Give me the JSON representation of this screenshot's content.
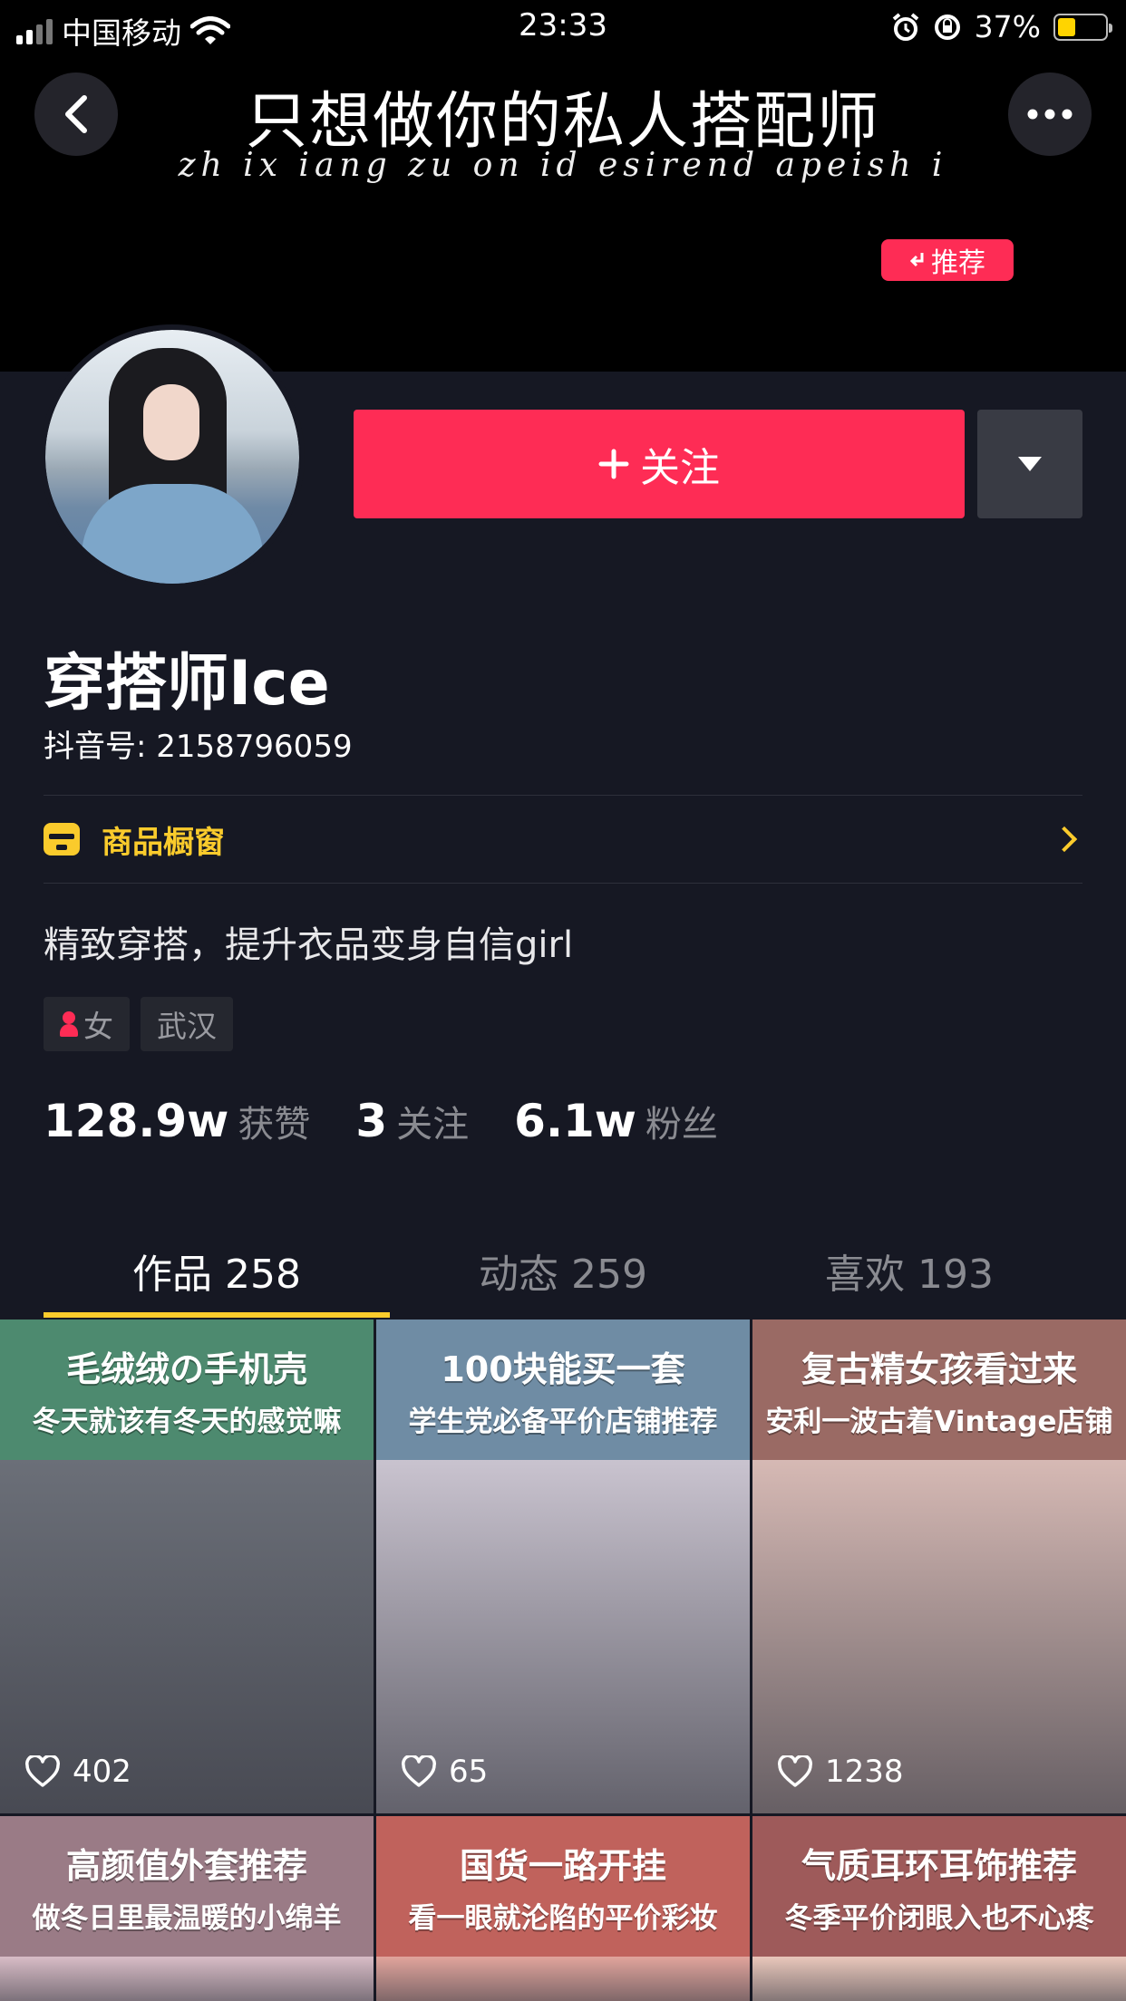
{
  "status_bar": {
    "carrier": "中国移动",
    "time": "23:33",
    "battery_percent": "37%",
    "battery_level": 0.37
  },
  "banner": {
    "title": "只想做你的私人搭配师",
    "pinyin": "zh ix iang zu on id esirend apeish i",
    "recommend_tag": "推荐"
  },
  "profile": {
    "follow_label": "关注",
    "nickname": "穿搭师Ice",
    "douyin_id": "抖音号: 2158796059",
    "shop_label": "商品橱窗",
    "bio": "精致穿搭，提升衣品变身自信girl",
    "tags": [
      "女",
      "武汉"
    ],
    "stats": [
      {
        "num": "128.9w",
        "label": "获赞"
      },
      {
        "num": "3",
        "label": "关注"
      },
      {
        "num": "6.1w",
        "label": "粉丝"
      }
    ]
  },
  "tabs": [
    {
      "label": "作品 258",
      "active": true
    },
    {
      "label": "动态 259",
      "active": false
    },
    {
      "label": "喜欢 193",
      "active": false
    }
  ],
  "videos": [
    {
      "line1": "毛绒绒の手机壳",
      "line2": "冬天就该有冬天的感觉嘛",
      "likes": "402",
      "head_color": "#4d8a6f",
      "photo_color": "#6b6f78"
    },
    {
      "line1": "100块能买一套",
      "line2": "学生党必备平价店铺推荐",
      "likes": "65",
      "head_color": "#6f8ca4",
      "photo_color": "#c9c3cf"
    },
    {
      "line1": "复古精女孩看过来",
      "line2": "安利一波古着Vintage店铺",
      "likes": "1238",
      "head_color": "#9a6a64",
      "photo_color": "#d6b9b4"
    },
    {
      "line1": "高颜值外套推荐",
      "line2": "做冬日里最温暖的小绵羊",
      "likes": "",
      "head_color": "#9a7b86",
      "photo_color": "#d8bcc6"
    },
    {
      "line1": "国货一路开挂",
      "line2": "看一眼就沦陷的平价彩妆",
      "likes": "",
      "head_color": "#c0625c",
      "photo_color": "#e1a49c"
    },
    {
      "line1": "气质耳环耳饰推荐",
      "line2": "冬季平价闭眼入也不心疼",
      "likes": "",
      "head_color": "#9e5a5a",
      "photo_color": "#e9c7bb"
    }
  ]
}
